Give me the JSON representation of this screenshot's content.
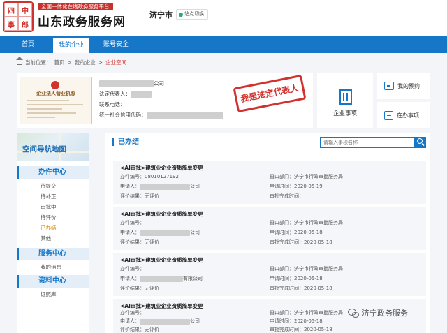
{
  "header": {
    "logo_chars": [
      "四",
      "中",
      "事",
      "郎"
    ],
    "slogan": "全国一体化在线政务服务平台",
    "site_title": "山东政务服务网",
    "city": "济宁市",
    "switch_label": "站点切换"
  },
  "nav": {
    "items": [
      {
        "label": "首页"
      },
      {
        "label": "我的企业"
      },
      {
        "label": "账号安全"
      }
    ]
  },
  "breadcrumb": {
    "prefix": "当前位置：",
    "items": [
      "首页",
      "我的企业"
    ],
    "current": "企业空间",
    "sep": ">"
  },
  "company": {
    "license_title": "企业法人营业执照",
    "name_suffix": "公司",
    "legal_rep_label": "法定代表人：",
    "phone_label": "联系电话：",
    "credit_code_label": "统一社会信用代码：",
    "stamp_text": "我是法定代表人"
  },
  "tiles": {
    "enterprise_label": "企业事项",
    "appointment_label": "我的预约",
    "in_progress_label": "在办事项"
  },
  "sidebar": {
    "map_label": "空间导航地图",
    "sections": [
      {
        "title": "办件中心",
        "items": [
          "待提交",
          "待补正",
          "审批中",
          "待评价",
          "已办结",
          "其他"
        ]
      },
      {
        "title": "服务中心",
        "items": [
          "我的消息"
        ]
      },
      {
        "title": "资料中心",
        "items": [
          "证照库"
        ]
      }
    ],
    "active_item": "已办结"
  },
  "results": {
    "title": "已办结",
    "search_placeholder": "请输入事项名称",
    "labels": {
      "number": "办件编号：",
      "applicant": "申请人：",
      "evaluation": "评价结果：",
      "dept": "窗口部门：",
      "apply_time": "申请时间：",
      "finish_time": "审批完成时间："
    },
    "records": [
      {
        "title": "<AI审批>建筑业企业资质简单变更",
        "number": "08010127192",
        "applicant_suffix": "公司",
        "evaluation": "无评价",
        "dept": "济宁市行政审批服务局",
        "apply_time": "2020-05-19",
        "finish_time": ""
      },
      {
        "title": "<AI审批>建筑业企业资质简单变更",
        "number": "",
        "applicant_suffix": "公司",
        "evaluation": "无评价",
        "dept": "济宁市行政审批服务局",
        "apply_time": "2020-05-18",
        "finish_time": "2020-05-18"
      },
      {
        "title": "<AI审批>建筑业企业资质简单变更",
        "number": "",
        "applicant_suffix": "有限公司",
        "evaluation": "无评价",
        "dept": "济宁市行政审批服务局",
        "apply_time": "2020-05-18",
        "finish_time": "2020-05-18"
      },
      {
        "title": "<AI审批>建筑业企业资质简单变更",
        "number": "",
        "applicant_suffix": "公司",
        "evaluation": "无评价",
        "dept": "济宁市行政审批服务局",
        "apply_time": "2020-05-18",
        "finish_time": "2020-05-18"
      }
    ]
  },
  "watermark": {
    "text": "济宁政务服务"
  },
  "colors": {
    "primary": "#1677c8",
    "accent_red": "#d2322d",
    "active_orange": "#e08a00"
  }
}
